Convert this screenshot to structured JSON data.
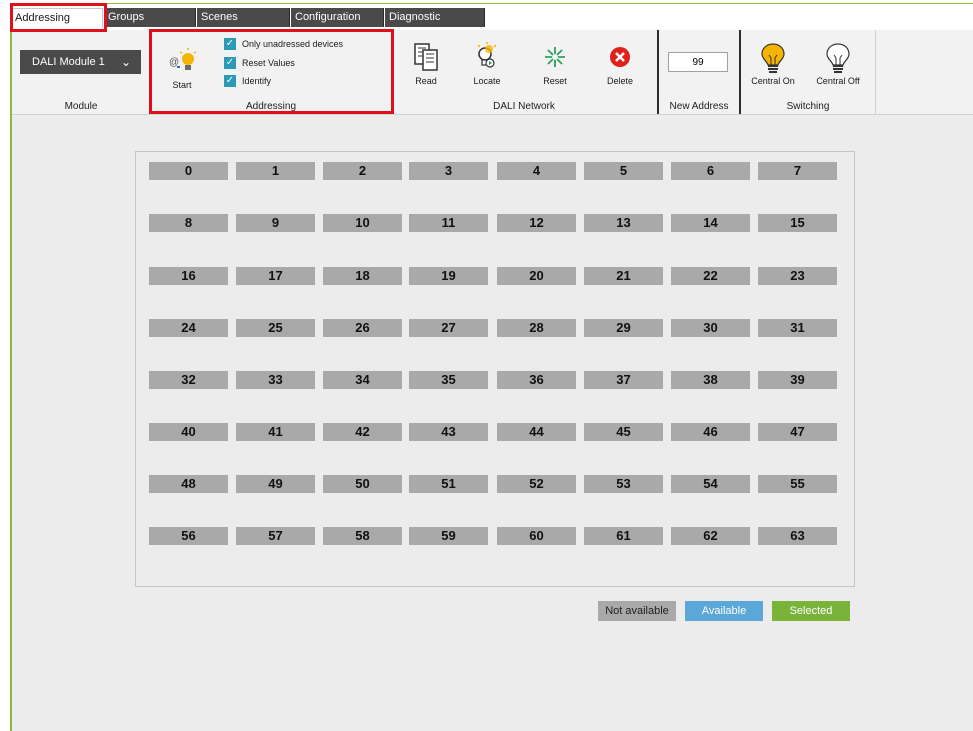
{
  "tabs": [
    "Addressing",
    "Groups",
    "Scenes",
    "Configuration",
    "Diagnostic"
  ],
  "ribbon": {
    "module": {
      "dropdown_value": "DALI Module 1",
      "group_label": "Module"
    },
    "addressing": {
      "start_label": "Start",
      "options": [
        {
          "label": "Only unadressed devices",
          "checked": true
        },
        {
          "label": "Reset Values",
          "checked": true
        },
        {
          "label": "Identify",
          "checked": true
        }
      ],
      "group_label": "Addressing"
    },
    "dali_network": {
      "buttons": [
        "Read",
        "Locate",
        "Reset",
        "Delete"
      ],
      "group_label": "DALI Network"
    },
    "new_address": {
      "value": "99",
      "group_label": "New Address"
    },
    "switching": {
      "buttons": [
        "Central On",
        "Central Off"
      ],
      "group_label": "Switching"
    }
  },
  "grid": {
    "cells": [
      "0",
      "1",
      "2",
      "3",
      "4",
      "5",
      "6",
      "7",
      "8",
      "9",
      "10",
      "11",
      "12",
      "13",
      "14",
      "15",
      "16",
      "17",
      "18",
      "19",
      "20",
      "21",
      "22",
      "23",
      "24",
      "25",
      "26",
      "27",
      "28",
      "29",
      "30",
      "31",
      "32",
      "33",
      "34",
      "35",
      "36",
      "37",
      "38",
      "39",
      "40",
      "41",
      "42",
      "43",
      "44",
      "45",
      "46",
      "47",
      "48",
      "49",
      "50",
      "51",
      "52",
      "53",
      "54",
      "55",
      "56",
      "57",
      "58",
      "59",
      "60",
      "61",
      "62",
      "63"
    ]
  },
  "legend": {
    "not_available": "Not available",
    "available": "Available",
    "selected": "Selected"
  },
  "colors": {
    "accent_green": "#8cbb3c",
    "not_available": "#a9a9a9",
    "available": "#5ba7d8",
    "selected": "#7ab33a",
    "highlight": "#e0101a"
  }
}
